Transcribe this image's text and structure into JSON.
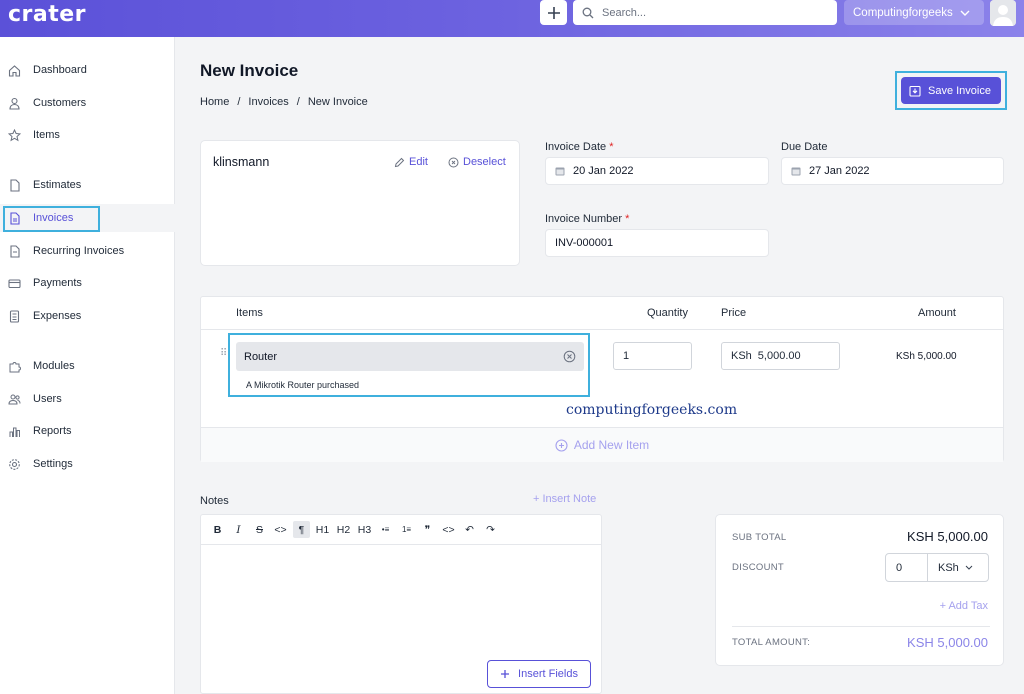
{
  "header": {
    "logo": "crater",
    "search_placeholder": "Search...",
    "company": "Computingforgeeks"
  },
  "sidebar": {
    "items": [
      {
        "label": "Dashboard",
        "icon": "home-icon"
      },
      {
        "label": "Customers",
        "icon": "user-icon"
      },
      {
        "label": "Items",
        "icon": "star-icon"
      },
      {
        "label": "Estimates",
        "icon": "document-icon"
      },
      {
        "label": "Invoices",
        "icon": "document-text-icon",
        "active": true
      },
      {
        "label": "Recurring Invoices",
        "icon": "document-icon"
      },
      {
        "label": "Payments",
        "icon": "credit-card-icon"
      },
      {
        "label": "Expenses",
        "icon": "calculator-icon"
      },
      {
        "label": "Modules",
        "icon": "puzzle-icon"
      },
      {
        "label": "Users",
        "icon": "users-icon"
      },
      {
        "label": "Reports",
        "icon": "chart-bar-icon"
      },
      {
        "label": "Settings",
        "icon": "cog-icon"
      }
    ]
  },
  "page": {
    "title": "New Invoice",
    "breadcrumb": [
      "Home",
      "Invoices",
      "New Invoice"
    ],
    "save_label": "Save Invoice"
  },
  "customer": {
    "name": "klinsmann",
    "edit_label": "Edit",
    "deselect_label": "Deselect"
  },
  "invoice": {
    "date_label": "Invoice Date",
    "date_value": "20 Jan 2022",
    "due_label": "Due Date",
    "due_value": "27 Jan 2022",
    "number_label": "Invoice Number",
    "number_value": "INV-000001",
    "required_mark": "*"
  },
  "items_table": {
    "headers": {
      "items": "Items",
      "quantity": "Quantity",
      "price": "Price",
      "amount": "Amount"
    },
    "rows": [
      {
        "name": "Router",
        "description": "A Mikrotik Router purchased",
        "quantity": "1",
        "currency": "KSh",
        "price": "5,000.00",
        "amount": "KSh 5,000.00"
      }
    ],
    "add_label": "Add New Item"
  },
  "watermark": "computingforgeeks.com",
  "notes": {
    "label": "Notes",
    "insert_note": "+ Insert Note",
    "toolbar": [
      "B",
      "I",
      "S",
      "<>",
      "¶",
      "H1",
      "H2",
      "H3",
      "•≡",
      "1≡",
      "❞",
      "<>",
      "↶",
      "↷"
    ],
    "insert_fields": "Insert Fields"
  },
  "totals": {
    "sub_total_label": "SUB TOTAL",
    "sub_total_value": "KSH 5,000.00",
    "discount_label": "DISCOUNT",
    "discount_value": "0",
    "discount_unit": "KSh",
    "add_tax": "+ Add Tax",
    "total_label": "TOTAL AMOUNT:",
    "total_value": "KSH 5,000.00"
  },
  "colors": {
    "primary": "#5851d8",
    "highlight": "#3fb0dd",
    "required": "#e02424"
  }
}
